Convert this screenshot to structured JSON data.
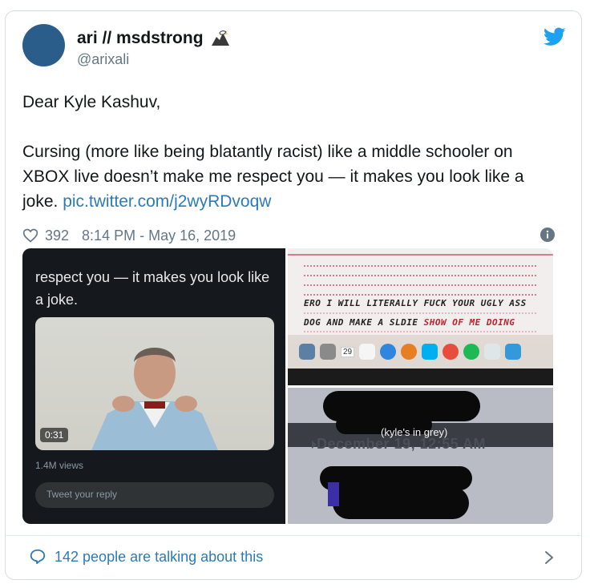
{
  "tweet": {
    "display_name": "ari // msdstrong",
    "handle": "@arixali",
    "text_line1": "Dear Kyle Kashuv,",
    "text_body": "Cursing (more like being blatantly racist) like a middle schooler on XBOX live doesn’t make me respect you — it makes you look like a joke.",
    "link": "pic.twitter.com/j2wyRDvoqw",
    "like_count": "392",
    "timestamp": "8:14 PM - May 16, 2019"
  },
  "media": {
    "left": {
      "caption": "respect you — it makes you look like a joke.",
      "video_duration": "0:31",
      "views": "1.4M views",
      "reply_placeholder": "Tweet your reply"
    },
    "right_top": {
      "handwriting_line1": "ERO I WILL LITERALLY FUCK YOUR UGLY ASS",
      "handwriting_line2_black": "DOG AND MAKE A SLDIE ",
      "handwriting_line2_red": "SHOW OF ME DOING",
      "dock_day": "29"
    },
    "right_bottom": {
      "caption": "(kyle's in grey)",
      "date_text": "December 19, 12:55 AM"
    }
  },
  "footer": {
    "conversation_text": "142 people are talking about this"
  },
  "colors": {
    "link": "#2b7bb9",
    "muted": "#657786",
    "twitter_blue": "#1da1f2",
    "avatar": "#2a5d8a"
  },
  "icons": [
    "eagle-icon",
    "twitter-bird-icon",
    "heart-icon",
    "info-icon",
    "speech-bubble-icon",
    "chevron-right-icon"
  ]
}
